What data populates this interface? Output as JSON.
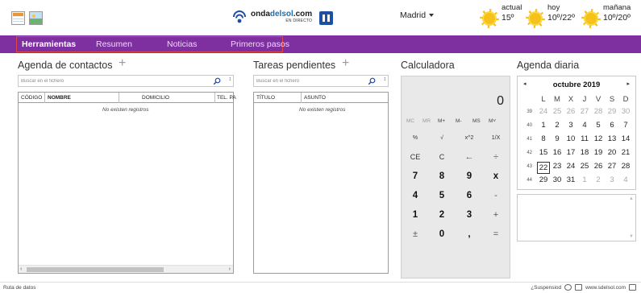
{
  "header": {
    "brand": {
      "part1": "onda",
      "part2": "delsol",
      "part3": ".com",
      "sub": "EN DIRECTO"
    },
    "city": "Madrid",
    "weather": [
      {
        "label": "actual",
        "value": "15º"
      },
      {
        "label": "hoy",
        "value": "10º/22º"
      },
      {
        "label": "mañana",
        "value": "10º/20º"
      }
    ]
  },
  "nav": {
    "items": [
      "Herramientas",
      "Resumen",
      "Noticias",
      "Primeros pasos"
    ],
    "active": "Herramientas",
    "highlight_color": "#e04646",
    "bar_color": "#7e2fa0"
  },
  "contacts": {
    "title": "Agenda de contactos",
    "search_placeholder": "Buscar en el fichero",
    "columns": [
      "CÓDIGO",
      "NOMBRE",
      "DOMICILIO",
      "TEL. PA"
    ],
    "empty": "No existen registros"
  },
  "tasks": {
    "title": "Tareas pendientes",
    "search_placeholder": "Buscar en el fichero",
    "columns": [
      "TÍTULO",
      "ASUNTO"
    ],
    "empty": "No existen registros"
  },
  "calculator": {
    "title": "Calculadora",
    "display": "0",
    "memory": [
      "MC",
      "MR",
      "M+",
      "M-",
      "MS",
      "M˅"
    ],
    "rows": [
      [
        "%",
        "√",
        "x^2",
        "1/X"
      ],
      [
        "CE",
        "C",
        "←",
        "÷"
      ],
      [
        "7",
        "8",
        "9",
        "x"
      ],
      [
        "4",
        "5",
        "6",
        "-"
      ],
      [
        "1",
        "2",
        "3",
        "+"
      ],
      [
        "±",
        "0",
        ",",
        "="
      ]
    ]
  },
  "agenda": {
    "title": "Agenda diaria",
    "month": "octubre 2019",
    "prev": "◂",
    "next": "▸",
    "weekdays": [
      "L",
      "M",
      "X",
      "J",
      "V",
      "S",
      "D"
    ],
    "weeks": [
      {
        "num": "39",
        "days": [
          "24",
          "25",
          "26",
          "27",
          "28",
          "29",
          "30"
        ],
        "muted": [
          0,
          1,
          2,
          3,
          4,
          5,
          6
        ]
      },
      {
        "num": "40",
        "days": [
          "1",
          "2",
          "3",
          "4",
          "5",
          "6",
          "7"
        ],
        "muted": []
      },
      {
        "num": "41",
        "days": [
          "8",
          "9",
          "10",
          "11",
          "12",
          "13",
          "14"
        ],
        "muted": []
      },
      {
        "num": "42",
        "days": [
          "15",
          "16",
          "17",
          "18",
          "19",
          "20",
          "21"
        ],
        "muted": []
      },
      {
        "num": "43",
        "days": [
          "22",
          "23",
          "24",
          "25",
          "26",
          "27",
          "28"
        ],
        "muted": []
      },
      {
        "num": "44",
        "days": [
          "29",
          "30",
          "31",
          "1",
          "2",
          "3",
          "4"
        ],
        "muted": [
          3,
          4,
          5,
          6
        ]
      }
    ],
    "today": "22"
  },
  "status": {
    "left": "Ruta de datos",
    "right_label": "¿Suspensiod",
    "right_link": "www.sdelsol.com"
  }
}
